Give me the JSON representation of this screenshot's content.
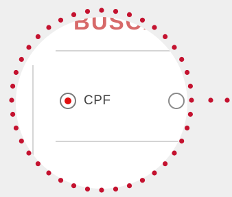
{
  "page": {
    "heading": "BUSCA",
    "search_type": {
      "selected_option_label": "CPF"
    }
  },
  "colors": {
    "background": "#efefef",
    "lens_fill": "#ffffff",
    "dot_outline": "#c4122f",
    "heading": "#d76a6a",
    "radio_selected": "#e01010"
  }
}
